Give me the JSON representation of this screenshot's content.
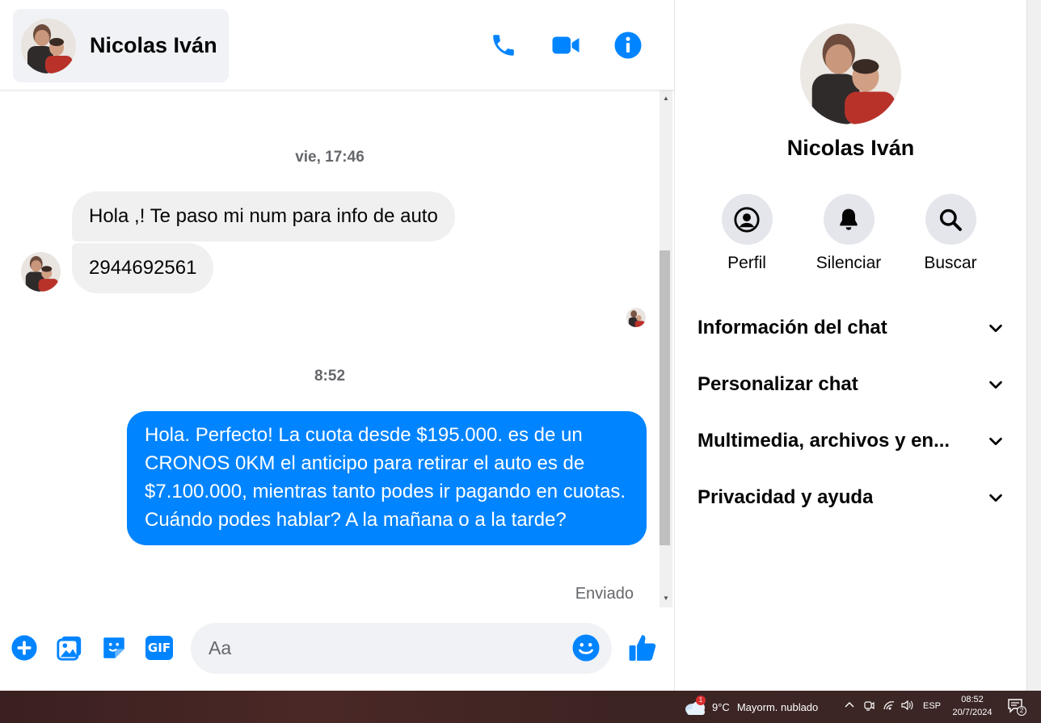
{
  "header": {
    "contact_name": "Nicolas Iván"
  },
  "messages": {
    "ts1": "vie, 17:46",
    "incoming": [
      "Hola ,! Te paso mi num para info de auto",
      "2944692561"
    ],
    "ts2": "8:52",
    "outgoing": "Hola. Perfecto! La cuota desde $195.000. es de un CRONOS 0KM el anticipo para retirar el auto es de $7.100.000, mientras tanto podes ir pagando en cuotas. Cuándo podes hablar? A la mañana o a la tarde?",
    "status": "Enviado"
  },
  "composer": {
    "placeholder": "Aa",
    "gif_label": "GIF"
  },
  "info": {
    "name": "Nicolas Iván",
    "actions": [
      "Perfil",
      "Silenciar",
      "Buscar"
    ],
    "sections": [
      "Información del chat",
      "Personalizar chat",
      "Multimedia, archivos y en...",
      "Privacidad y ayuda"
    ]
  },
  "taskbar": {
    "weather_badge": "1",
    "temperature": "9°C",
    "weather_text": "Mayorm. nublado",
    "language": "ESP",
    "time": "08:52",
    "date": "20/7/2024",
    "notifications": "2"
  },
  "colors": {
    "accent": "#0084ff",
    "incoming_bubble": "#f0f0f0",
    "secondary_text": "#65676b"
  }
}
